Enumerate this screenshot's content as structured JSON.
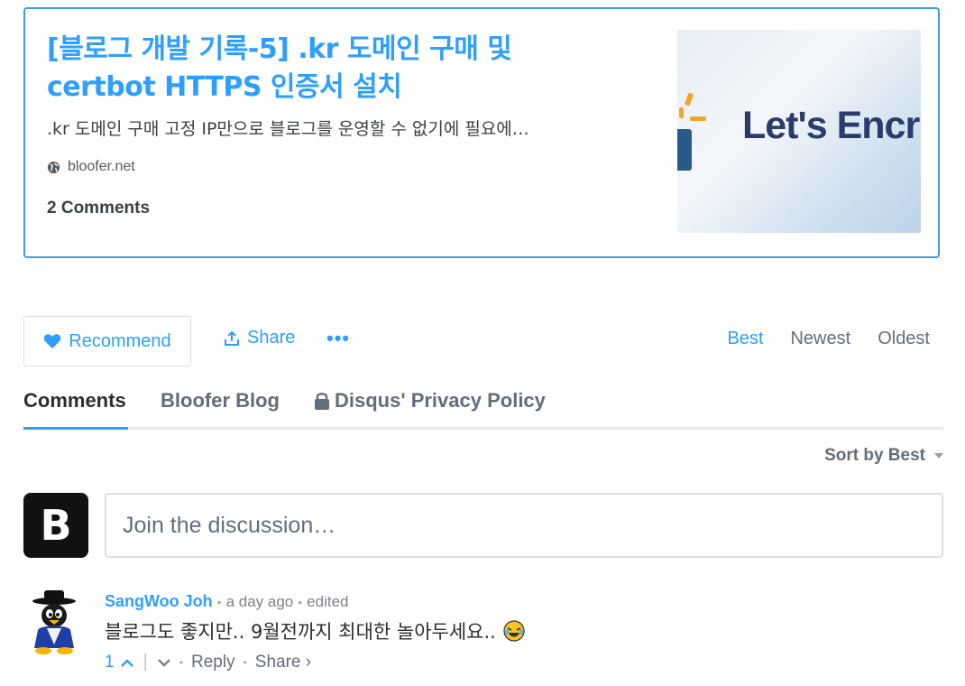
{
  "card": {
    "title": "[블로그 개발 기록-5] .kr 도메인 구매 및 certbot HTTPS 인증서 설치",
    "description": ".kr 도메인 구매 고정 IP만으로 블로그를 운영할 수 없기에 필요에…",
    "domain": "bloofer.net",
    "comments": "2 Comments",
    "thumbnail_text": "Let's Encr"
  },
  "actions": {
    "recommend": "Recommend",
    "share": "Share",
    "more": "•••"
  },
  "sort_tabs": [
    {
      "label": "Best",
      "active": true
    },
    {
      "label": "Newest",
      "active": false
    },
    {
      "label": "Oldest",
      "active": false
    }
  ],
  "nav": {
    "comments": "Comments",
    "blog": "Bloofer Blog",
    "privacy": "Disqus' Privacy Policy"
  },
  "sort_dropdown": "Sort by Best",
  "composer": {
    "avatar_letter": "B",
    "placeholder": "Join the discussion…"
  },
  "comment": {
    "author": "SangWoo Joh",
    "time": "a day ago",
    "edited": "edited",
    "body": "블로그도 좋지만.. 9월전까지 최대한 놀아두세요..",
    "votes": "1",
    "reply": "Reply",
    "share": "Share ›"
  },
  "colors": {
    "accent": "#2e9fff",
    "text": "#2a2e2e",
    "muted": "#656c7a",
    "border": "#dbdfe4"
  }
}
